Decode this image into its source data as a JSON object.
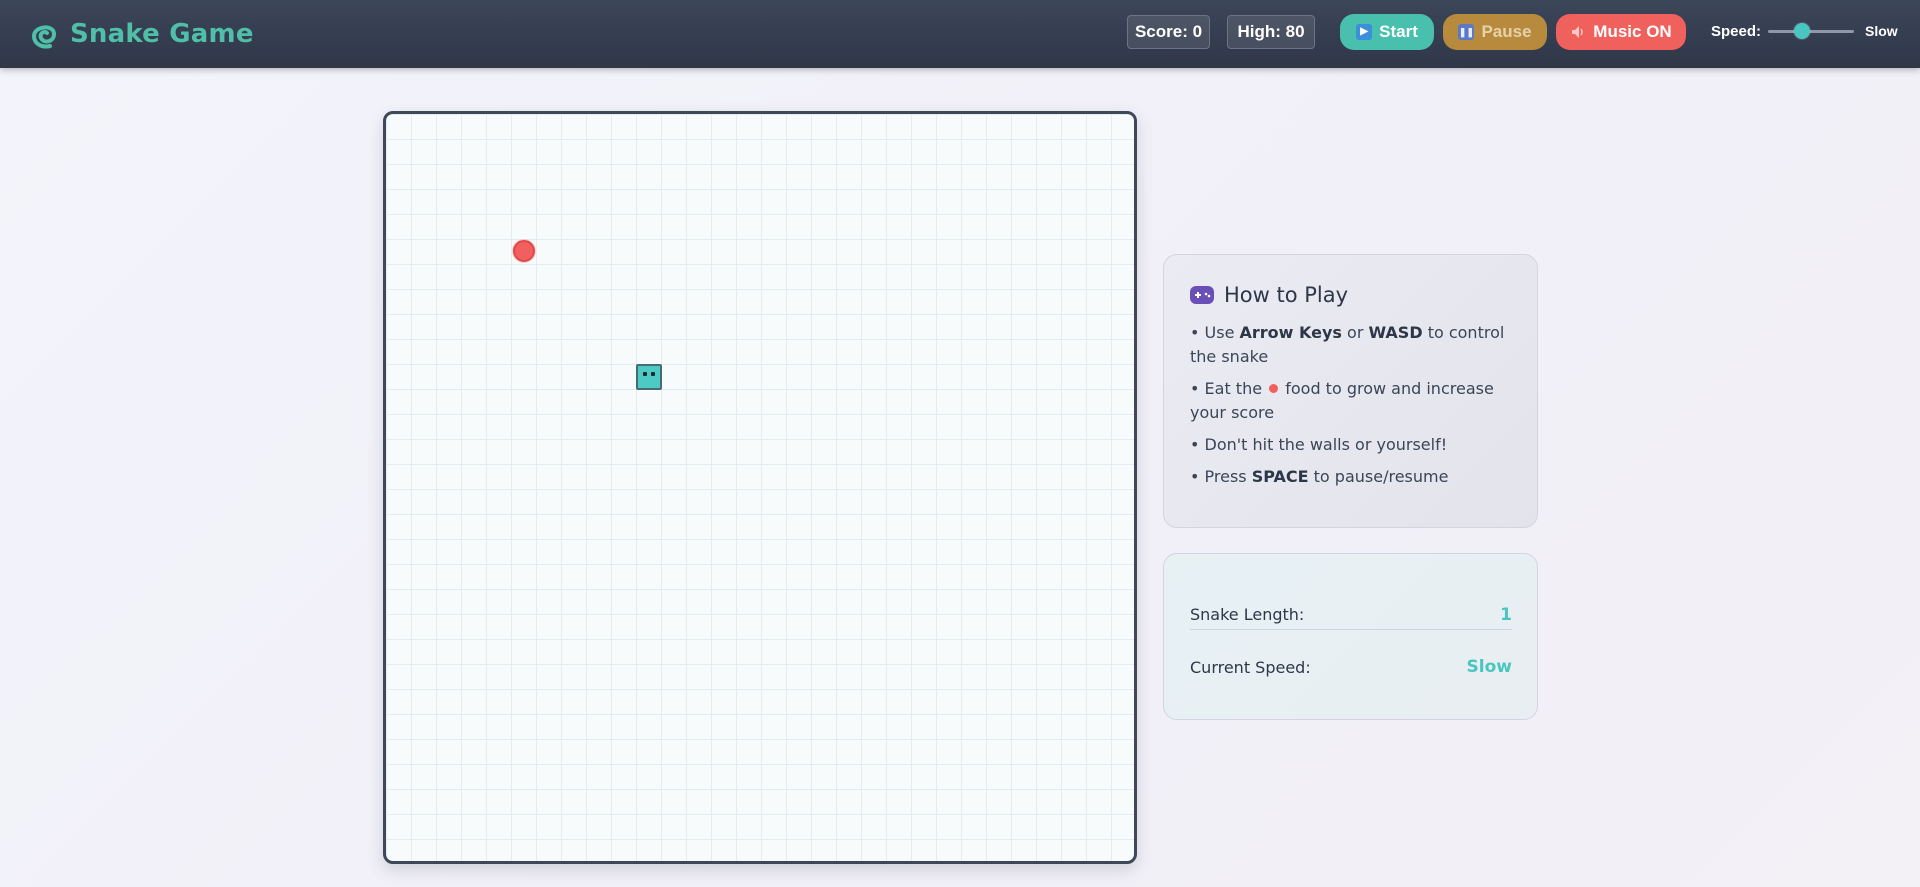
{
  "header": {
    "title": "Snake Game",
    "score_label": "Score: 0",
    "high_label": "High: 80",
    "start_label": "Start",
    "pause_label": "Pause",
    "music_label": "Music ON",
    "speed_label": "Speed:",
    "speed_value": "Slow",
    "speed_level": 0.4
  },
  "board": {
    "grid_columns": 30,
    "grid_rows": 30,
    "food": {
      "col": 5,
      "row": 5,
      "color": "#f15f5f"
    },
    "snake": [
      {
        "col": 10,
        "row": 10
      }
    ],
    "snake_color": "#4ccac3"
  },
  "howto": {
    "title": "How to Play",
    "rules": {
      "r1_prefix": "• Use ",
      "r1_key1": "Arrow Keys",
      "r1_mid": " or ",
      "r1_key2": "WASD",
      "r1_suffix": " to control the snake",
      "r2_prefix": "• Eat the ",
      "r2_suffix": " food to grow and increase your score",
      "r3": "• Don't hit the walls or yourself!",
      "r4_prefix": "• Press ",
      "r4_key": "SPACE",
      "r4_suffix": " to pause/resume"
    }
  },
  "stats": {
    "length_label": "Snake Length:",
    "length_value": "1",
    "speed_label": "Current Speed:",
    "speed_value": "Slow"
  },
  "colors": {
    "accent": "#4ac6c0",
    "start": "#49bfae",
    "pause": "#b88a3e",
    "music": "#f0605c",
    "header_bg": "#343d4f"
  },
  "icons": {
    "brand": "snake-logo-icon",
    "start": "play-icon",
    "pause": "pause-icon",
    "music": "speaker-icon",
    "howto": "gamepad-icon"
  }
}
